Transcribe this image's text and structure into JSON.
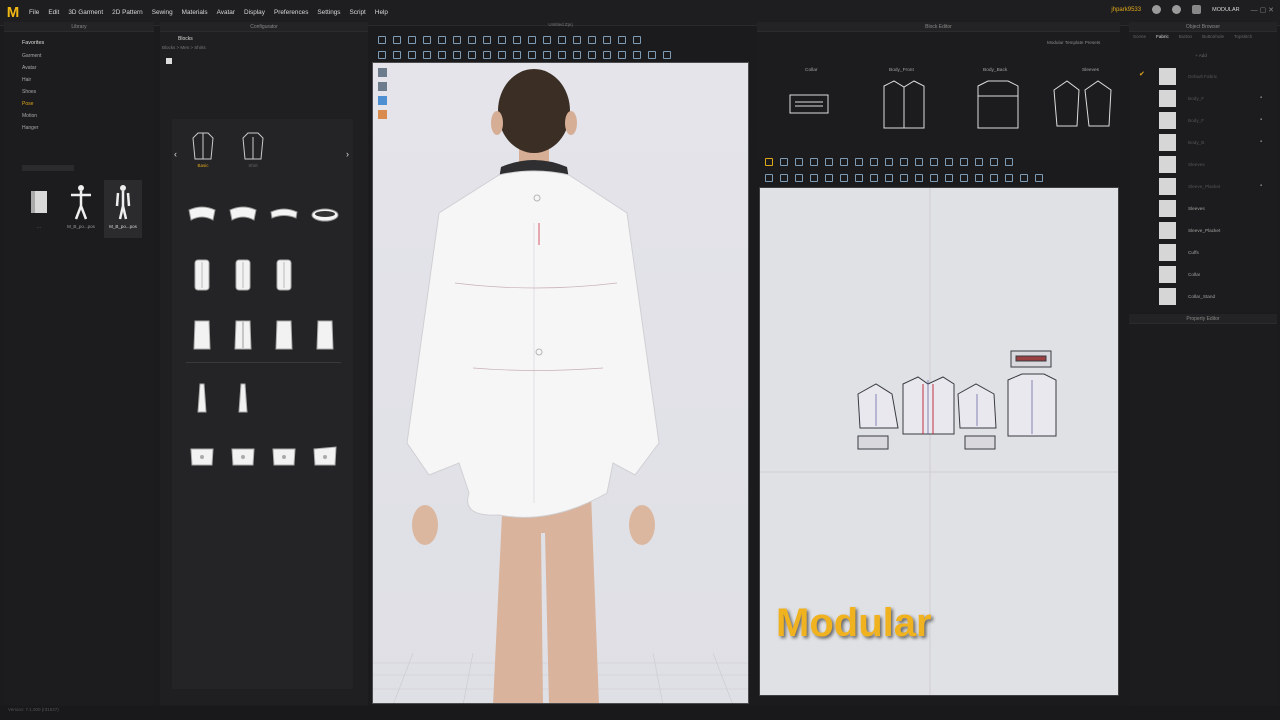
{
  "menubar": {
    "logo": "M",
    "items": [
      "File",
      "Edit",
      "3D Garment",
      "2D Pattern",
      "Sewing",
      "Materials",
      "Avatar",
      "Display",
      "Preferences",
      "Settings",
      "Script",
      "Help"
    ],
    "user": "jhpark9533",
    "workspace": "MODULAR"
  },
  "library": {
    "header": "Library",
    "favorites_title": "Favorites",
    "favorites": [
      "Garment",
      "Avatar",
      "Hair",
      "Shoes",
      "Pose",
      "Motion",
      "Hanger"
    ],
    "active_favorite": "Pose",
    "thumbs": [
      {
        "label": "..."
      },
      {
        "label": "M_B_po...pos"
      },
      {
        "label": "M_B_po...pos"
      }
    ]
  },
  "configurator": {
    "header": "Configurator",
    "tab_blocks": "Blocks",
    "breadcrumb": "Blocks > Men > Shirts",
    "style_tabs": [
      "Basic",
      "Shirt"
    ],
    "active_style": "Basic"
  },
  "viewport": {
    "title": "Untitled.Zprj"
  },
  "block_editor": {
    "header": "Block Editor",
    "template_presets": "Modular Template Presets",
    "columns": [
      "Collar",
      "Body_Front",
      "Body_Back",
      "Sleeves"
    ]
  },
  "pattern": {
    "caption": "Modular"
  },
  "object_browser": {
    "header": "Object Browser",
    "tabs": [
      "Scene",
      "Fabric",
      "Button",
      "Buttonhole",
      "Topstitch"
    ],
    "active_tab": "Fabric",
    "add_label": "+ Add",
    "items": [
      {
        "label": "Default Fabric",
        "dim": true,
        "check": true
      },
      {
        "label": "Body_F",
        "dim": true
      },
      {
        "label": "Body_F",
        "dim": true
      },
      {
        "label": "Body_B",
        "dim": true
      },
      {
        "label": "Sleeves",
        "dim": true
      },
      {
        "label": "Sleeve_Placket",
        "dim": true
      },
      {
        "label": "Sleeves",
        "dim": false
      },
      {
        "label": "Sleeve_Placket",
        "dim": false
      },
      {
        "label": "Cuffs",
        "dim": false
      },
      {
        "label": "Collar",
        "dim": false
      },
      {
        "label": "Collar_Stand",
        "dim": false
      }
    ]
  },
  "property_editor": {
    "header": "Property Editor"
  },
  "statusbar": {
    "text": "Version: 7.1.000 (r31047)"
  }
}
